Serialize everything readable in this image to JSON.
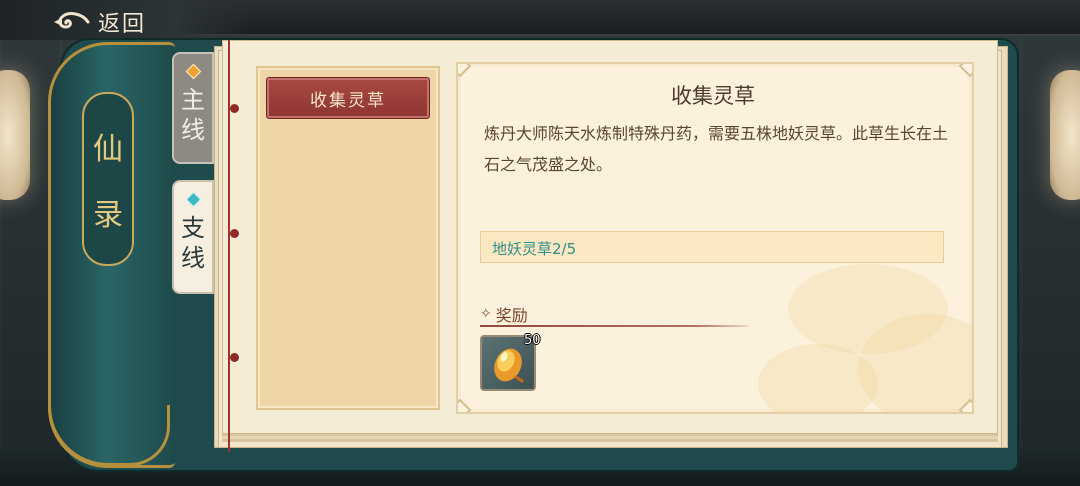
{
  "header": {
    "back_label": "返回"
  },
  "book": {
    "spine_chars": [
      "仙",
      "录"
    ]
  },
  "tabs": [
    {
      "label": "主线",
      "active": false
    },
    {
      "label": "支线",
      "active": true
    }
  ],
  "quest_list": [
    {
      "label": "收集灵草",
      "selected": true
    }
  ],
  "quest_detail": {
    "title": "收集灵草",
    "description": "炼丹大师陈天水炼制特殊丹药，需要五株地妖灵草。此草生长在土石之气茂盛之处。",
    "objective": "地妖灵草2/5",
    "reward_header": "奖励",
    "rewards": [
      {
        "name": "spirit-herb-item-icon",
        "count": "50"
      }
    ]
  },
  "colors": {
    "accent_red": "#a94a43",
    "objective_teal": "#2f8f8a",
    "book_green": "#1f4b4c",
    "gold_trim": "#b6903d",
    "main_tab_diamond": "#f0a030",
    "side_tab_diamond": "#3fb6c6"
  }
}
